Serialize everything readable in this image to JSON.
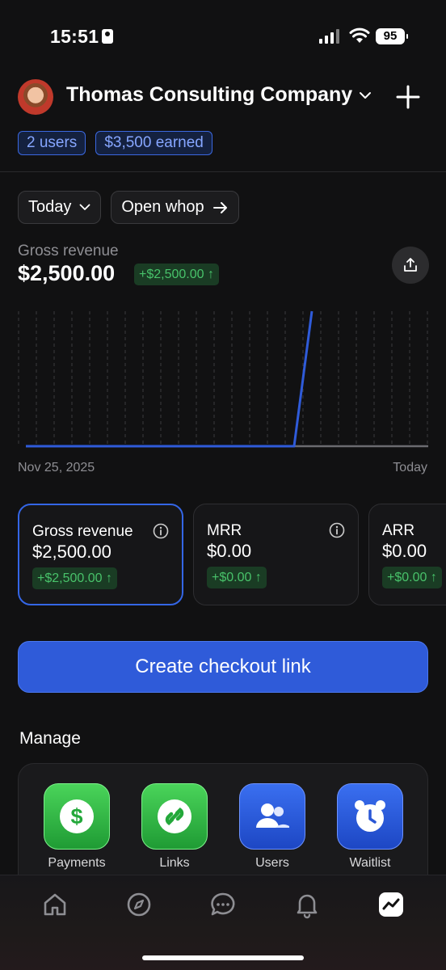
{
  "status_bar": {
    "time": "15:51",
    "battery": "95"
  },
  "header": {
    "company": "Thomas Consulting Company"
  },
  "badges": {
    "users": "2 users",
    "earned": "$3,500 earned"
  },
  "filters": {
    "range": "Today",
    "open_whop": "Open whop"
  },
  "revenue": {
    "label": "Gross revenue",
    "value": "$2,500.00",
    "delta": "+$2,500.00 ↑",
    "start_date": "Nov 25, 2025",
    "end_date": "Today"
  },
  "chart_data": {
    "type": "line",
    "x": [
      "Nov 25, 2025",
      "",
      "",
      "",
      "",
      "",
      "",
      "",
      "",
      "",
      "",
      "",
      "",
      "",
      "",
      "",
      "",
      "",
      "",
      "",
      "",
      "",
      "",
      "Today"
    ],
    "series": [
      {
        "values": [
          0,
          0,
          0,
          0,
          0,
          0,
          0,
          0,
          0,
          0,
          0,
          0,
          0,
          0,
          0,
          2500
        ]
      }
    ],
    "ylim": [
      0,
      2500
    ],
    "grid": true,
    "colors": {
      "line": "#2f5bd9",
      "baseline": "#6b6b70",
      "grid": "#3a3a3e"
    }
  },
  "metrics": [
    {
      "label": "Gross revenue",
      "value": "$2,500.00",
      "delta": "+$2,500.00 ↑",
      "active": true
    },
    {
      "label": "MRR",
      "value": "$0.00",
      "delta": "+$0.00 ↑",
      "active": false
    },
    {
      "label": "ARR",
      "value": "$0.00",
      "delta": "+$0.00 ↑",
      "active": false
    }
  ],
  "cta": {
    "label": "Create checkout link"
  },
  "manage": {
    "title": "Manage",
    "tiles": [
      {
        "label": "Payments",
        "icon": "dollar-icon",
        "color": "green"
      },
      {
        "label": "Links",
        "icon": "link-icon",
        "color": "green"
      },
      {
        "label": "Users",
        "icon": "users-icon",
        "color": "blue"
      },
      {
        "label": "Waitlist",
        "icon": "alarm-clock-icon",
        "color": "blue"
      }
    ]
  },
  "tabs": [
    {
      "icon": "home-icon"
    },
    {
      "icon": "compass-icon"
    },
    {
      "icon": "chat-icon"
    },
    {
      "icon": "bell-icon"
    },
    {
      "icon": "analytics-icon",
      "active": true
    }
  ]
}
